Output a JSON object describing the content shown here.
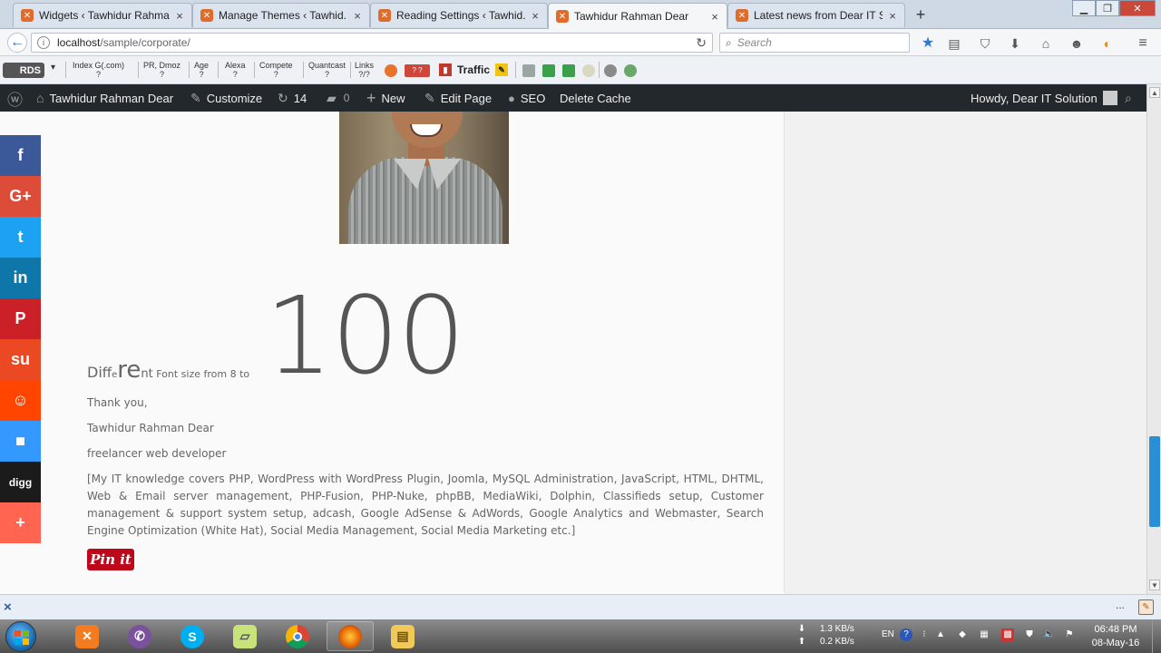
{
  "tabs": [
    {
      "title": "Widgets ‹ Tawhidur Rahma...",
      "active": false
    },
    {
      "title": "Manage Themes ‹ Tawhid...",
      "active": false
    },
    {
      "title": "Reading Settings ‹ Tawhid...",
      "active": false
    },
    {
      "title": "Tawhidur Rahman Dear",
      "active": true
    },
    {
      "title": "Latest news from Dear IT S...",
      "active": false
    }
  ],
  "tab_close_glyph": "×",
  "new_tab_glyph": "+",
  "address": {
    "host": "localhost",
    "path": "/sample/corporate/"
  },
  "search": {
    "placeholder": "Search"
  },
  "seo_toolbar": {
    "rds": "RDS",
    "index": "Index G(.com)",
    "index_val": "?",
    "pr": "PR, Dmoz",
    "pr_val": "?",
    "age": "Age",
    "age_val": "?",
    "alexa": "Alexa",
    "alexa_val": "?",
    "compete": "Compete",
    "compete_val": "?",
    "quantcast": "Quantcast",
    "quantcast_val": "?",
    "links": "Links",
    "links_val": "?/?",
    "gplus": "? ?",
    "traffic": "Traffic"
  },
  "admin_bar": {
    "site": "Tawhidur Rahman Dear",
    "customize": "Customize",
    "updates": "14",
    "comments": "0",
    "new": "New",
    "edit": "Edit Page",
    "seo": "SEO",
    "cache": "Delete Cache",
    "howdy": "Howdy, Dear IT Solution"
  },
  "article": {
    "diff_parts": [
      "Di",
      "ff",
      "e",
      "re",
      "nt",
      " Font size from 8 to"
    ],
    "big_number": "100",
    "thanks": "Thank you,",
    "name": "Tawhidur Rahman Dear",
    "role": "freelancer web developer",
    "knowledge": "[My IT knowledge covers PHP, WordPress with WordPress Plugin, Joomla, MySQL Administration, JavaScript, HTML, DHTML, Web & Email server management, PHP-Fusion, PHP-Nuke, phpBB, MediaWiki, Dolphin, Classifieds setup, Customer management & support system setup, adcash, Google AdSense & AdWords, Google Analytics and Webmaster, Search Engine Optimization (White Hat), Social Media Management, Social Media Marketing etc.]",
    "pin": "Pin it"
  },
  "share": [
    {
      "name": "facebook",
      "glyph": "f",
      "color": "#3b5998"
    },
    {
      "name": "google-plus",
      "glyph": "G+",
      "color": "#dd4b39"
    },
    {
      "name": "twitter",
      "glyph": "t",
      "color": "#1da1f2"
    },
    {
      "name": "linkedin",
      "glyph": "in",
      "color": "#0e76a8"
    },
    {
      "name": "pinterest",
      "glyph": "P",
      "color": "#cb2027"
    },
    {
      "name": "stumbleupon",
      "glyph": "su",
      "color": "#eb4924"
    },
    {
      "name": "reddit",
      "glyph": "☺",
      "color": "#ff4500"
    },
    {
      "name": "delicious",
      "glyph": "■",
      "color": "#3399ff"
    },
    {
      "name": "digg",
      "glyph": "digg",
      "color": "#1b1b1b"
    },
    {
      "name": "more",
      "glyph": "+",
      "color": "#ff6550"
    }
  ],
  "findbar": {
    "close": "×",
    "dots": "..."
  },
  "tray": {
    "down": "1.3 KB/s",
    "up": "0.2 KB/s",
    "lang": "EN",
    "time": "06:48 PM",
    "date": "08-May-16"
  }
}
